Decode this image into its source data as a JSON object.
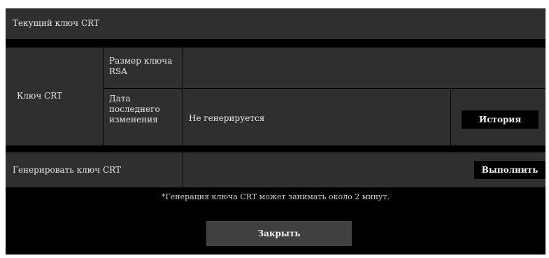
{
  "header": {
    "title": "Текущий ключ CRT"
  },
  "crt_key": {
    "label": "Ключ CRT",
    "rsa_size_label": "Размер ключа RSA",
    "rsa_size_value": "",
    "last_changed_label": "Дата последнего изменения",
    "last_changed_value": "Не генерируется",
    "history_button": "История"
  },
  "generate": {
    "label": "Генерировать ключ CRT",
    "execute_button": "Выполнить",
    "note": "*Генерация ключа CRT может занимать около 2 минут."
  },
  "footer": {
    "close_button": "Закрыть"
  }
}
